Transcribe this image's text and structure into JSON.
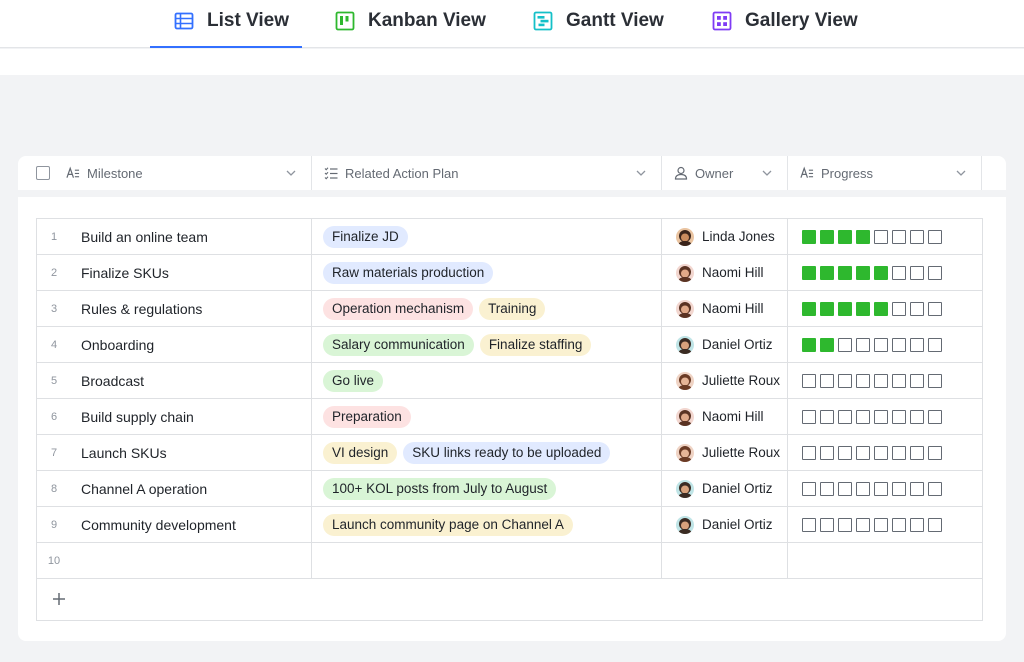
{
  "tabs": [
    {
      "label": "List View",
      "icon": "list-view-icon",
      "color": "#3370ff",
      "active": true
    },
    {
      "label": "Kanban View",
      "icon": "kanban-view-icon",
      "color": "#2eb82e"
    },
    {
      "label": "Gantt View",
      "icon": "gantt-view-icon",
      "color": "#14c0c8"
    },
    {
      "label": "Gallery View",
      "icon": "gallery-view-icon",
      "color": "#7f3bf5"
    }
  ],
  "columns": {
    "milestone": "Milestone",
    "plan": "Related Action Plan",
    "owner": "Owner",
    "progress": "Progress"
  },
  "tag_colors": {
    "blue": {
      "bg": "#e1eaff",
      "fg": "#1f2329"
    },
    "red": {
      "bg": "#fde2e2",
      "fg": "#1f2329"
    },
    "yellow": {
      "bg": "#faf1d1",
      "fg": "#1f2329"
    },
    "green": {
      "bg": "#d9f5d6",
      "fg": "#1f2329"
    }
  },
  "progress_total": 8,
  "progress_color": "#2eb82e",
  "rows": [
    {
      "num": "1",
      "milestone": "Build an online team",
      "plans": [
        {
          "text": "Finalize JD",
          "color": "blue"
        }
      ],
      "owner": "Linda Jones",
      "avatar": "linda",
      "progress": 4
    },
    {
      "num": "2",
      "milestone": "Finalize SKUs",
      "plans": [
        {
          "text": "Raw materials production",
          "color": "blue"
        }
      ],
      "owner": "Naomi Hill",
      "avatar": "naomi",
      "progress": 5
    },
    {
      "num": "3",
      "milestone": "Rules & regulations",
      "plans": [
        {
          "text": "Operation mechanism",
          "color": "red"
        },
        {
          "text": "Training",
          "color": "yellow"
        }
      ],
      "owner": "Naomi Hill",
      "avatar": "naomi",
      "progress": 5
    },
    {
      "num": "4",
      "milestone": "Onboarding",
      "plans": [
        {
          "text": "Salary communication",
          "color": "green"
        },
        {
          "text": "Finalize staffing",
          "color": "yellow"
        }
      ],
      "owner": "Daniel Ortiz",
      "avatar": "daniel",
      "progress": 2
    },
    {
      "num": "5",
      "milestone": "Broadcast",
      "plans": [
        {
          "text": "Go live",
          "color": "green"
        }
      ],
      "owner": "Juliette Roux",
      "avatar": "juliette",
      "progress": 0
    },
    {
      "num": "6",
      "milestone": "Build supply chain",
      "plans": [
        {
          "text": "Preparation",
          "color": "red"
        }
      ],
      "owner": "Naomi Hill",
      "avatar": "naomi",
      "progress": 0
    },
    {
      "num": "7",
      "milestone": "Launch SKUs",
      "plans": [
        {
          "text": "VI design",
          "color": "yellow"
        },
        {
          "text": "SKU links ready to be uploaded",
          "color": "blue"
        }
      ],
      "owner": "Juliette Roux",
      "avatar": "juliette",
      "progress": 0
    },
    {
      "num": "8",
      "milestone": "Channel A operation",
      "plans": [
        {
          "text": "100+ KOL posts from July to August",
          "color": "green"
        }
      ],
      "owner": "Daniel Ortiz",
      "avatar": "daniel",
      "progress": 0
    },
    {
      "num": "9",
      "milestone": "Community development",
      "plans": [
        {
          "text": "Launch community page on Channel A",
          "color": "yellow"
        }
      ],
      "owner": "Daniel Ortiz",
      "avatar": "daniel",
      "progress": 0
    },
    {
      "num": "10",
      "milestone": "",
      "plans": [],
      "owner": "",
      "avatar": "",
      "progress": null
    }
  ],
  "add_row_icon": "plus-icon"
}
